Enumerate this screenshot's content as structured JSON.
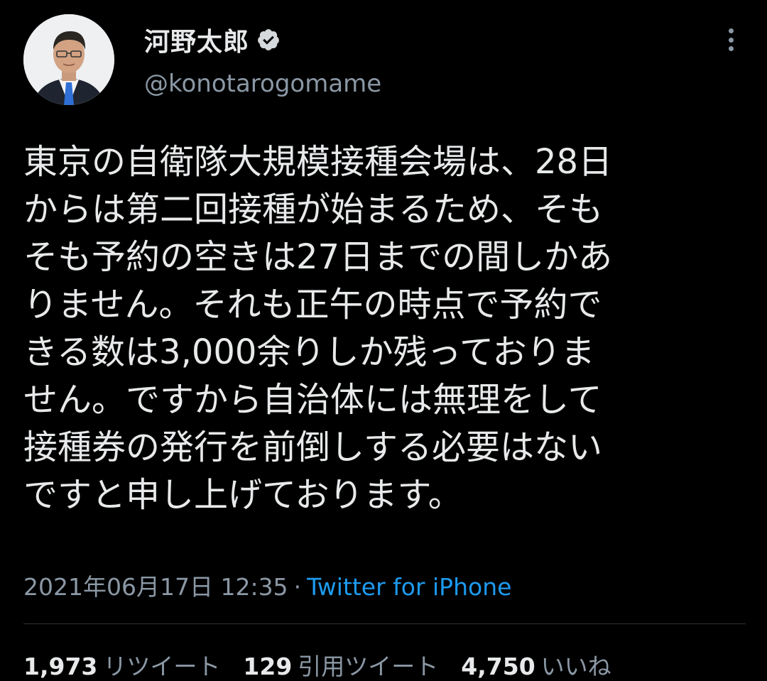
{
  "author": {
    "display_name": "河野太郎",
    "handle": "@konotarogomame",
    "verified": true,
    "avatar_icon": "profile-photo"
  },
  "tweet": {
    "lines": [
      "東京の自衛隊大規模接種会場は、28日",
      "からは第二回接種が始まるため、そも",
      "そも予約の空きは27日までの間しかあ",
      "りません。それも正午の時点で予約で",
      "きる数は3,000余りしか残っておりま",
      "せん。ですから自治体には無理をして",
      "接種券の発行を前倒しする必要はない",
      "ですと申し上げております。"
    ],
    "timestamp": "2021年06月17日 12:35",
    "separator": "·",
    "source": "Twitter for iPhone"
  },
  "stats": {
    "retweets": {
      "count": "1,973",
      "label": "リツイート"
    },
    "quotes": {
      "count": "129",
      "label": "引用ツイート"
    },
    "likes": {
      "count": "4,750",
      "label": "いいね"
    }
  },
  "colors": {
    "background": "#000000",
    "text": "#e7e9ea",
    "secondary": "#8b98a5",
    "link": "#1d9bf0",
    "divider": "#2f3336"
  }
}
